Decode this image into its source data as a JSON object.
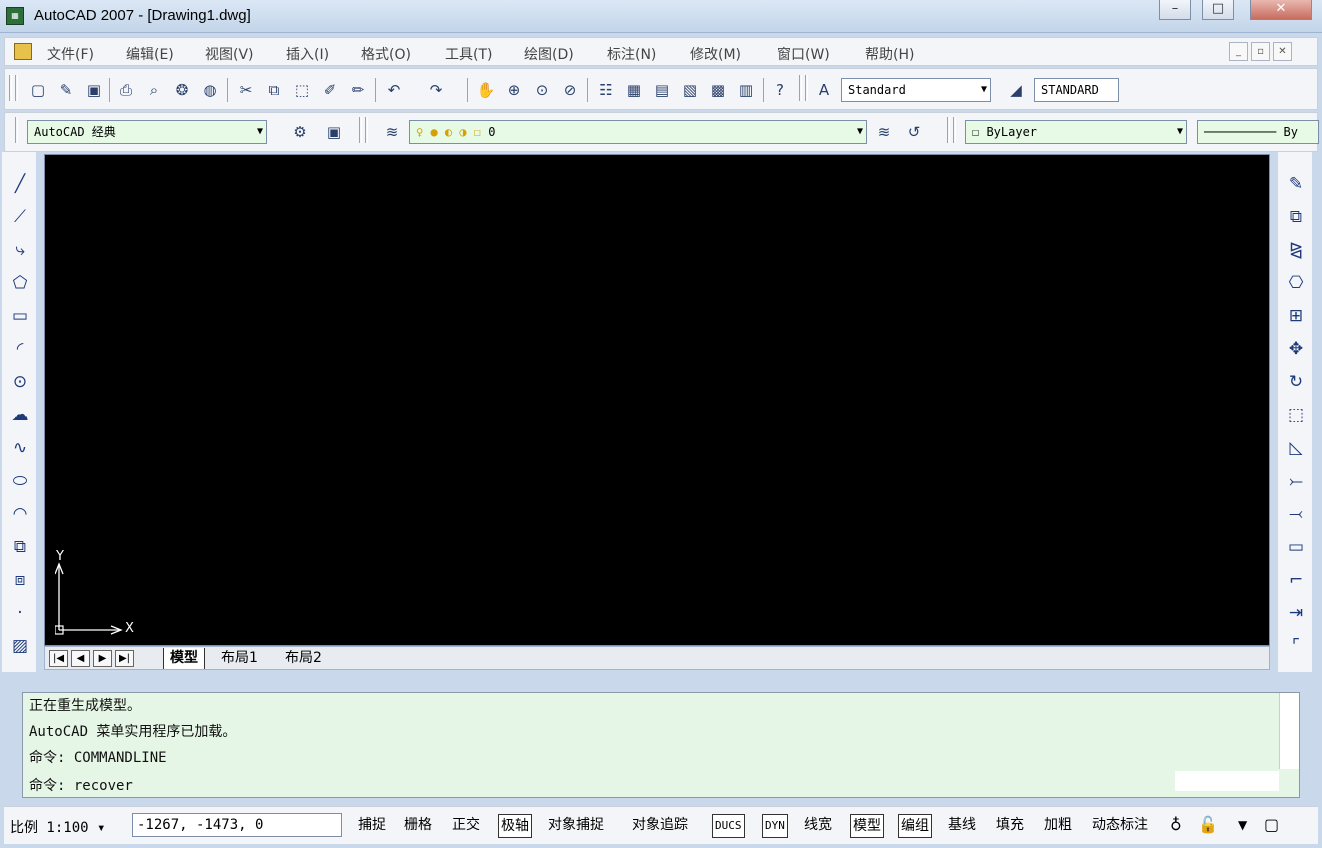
{
  "window": {
    "title": "AutoCAD 2007 - [Drawing1.dwg]"
  },
  "menubar": {
    "items": [
      "文件(F)",
      "编辑(E)",
      "视图(V)",
      "插入(I)",
      "格式(O)",
      "工具(T)",
      "绘图(D)",
      "标注(N)",
      "修改(M)",
      "窗口(W)",
      "帮助(H)"
    ]
  },
  "toolbar1": {
    "text_style": "Standard",
    "dim_style": "STANDARD"
  },
  "toolbar2": {
    "workspace": "AutoCAD 经典",
    "layer": "0",
    "color": "ByLayer",
    "linetype_tail": "By"
  },
  "canvas": {
    "ucs_x": "X",
    "ucs_y": "Y"
  },
  "layout_tabs": [
    "模型",
    "布局1",
    "布局2"
  ],
  "command": {
    "history": [
      "正在重生成模型。",
      "AutoCAD 菜单实用程序已加载。",
      "命令: COMMANDLINE"
    ],
    "current": "命令: recover"
  },
  "status": {
    "scale": "比例 1:100 ▾",
    "coords": "-1267, -1473, 0",
    "toggles": [
      "捕捉",
      "栅格",
      "正交",
      "极轴",
      "对象捕捉",
      "对象追踪",
      "DUCS",
      "DYN",
      "线宽",
      "模型",
      "编组",
      "基线",
      "填充",
      "加粗",
      "动态标注"
    ]
  },
  "colors": {
    "canvas": "#000000",
    "command_bg": "#e6f6e6",
    "chrome": "#f3f5f8"
  }
}
